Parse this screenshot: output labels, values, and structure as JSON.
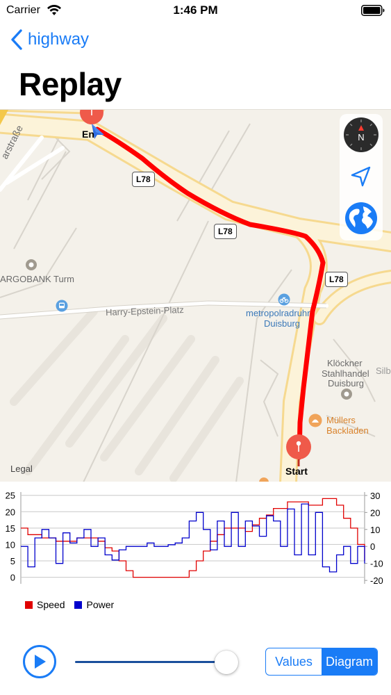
{
  "status_bar": {
    "carrier": "Carrier",
    "time": "1:46 PM"
  },
  "nav": {
    "back_label": "highway",
    "title": "Replay"
  },
  "map": {
    "labels": {
      "street_fragment": "arstraße",
      "argobank": "ARGOBANK Turm",
      "square": "Harry-Epstein-Platz",
      "station_1": "metropolradruhr",
      "station_2": "Duisburg",
      "kloeckner_1": "Klöckner",
      "kloeckner_2": "Stahlhandel",
      "kloeckner_3": "Duisburg",
      "silb": "Silb",
      "bakery_1": "Müllers",
      "bakery_2": "Backladen",
      "legal": "Legal"
    },
    "road_shields": [
      "L78",
      "L78",
      "L78"
    ],
    "start_label": "Start",
    "end_label": "En",
    "compass_letter": "N",
    "route_color": "#ff0000"
  },
  "chart_data": {
    "type": "line",
    "x": [
      0,
      1,
      2,
      3,
      4,
      5,
      6,
      7,
      8,
      9,
      10,
      11,
      12,
      13,
      14,
      15,
      16,
      17,
      18,
      19,
      20,
      21,
      22,
      23,
      24,
      25,
      26,
      27,
      28,
      29,
      30,
      31,
      32,
      33,
      34,
      35,
      36,
      37,
      38,
      39,
      40,
      41,
      42,
      43,
      44,
      45,
      46,
      47,
      48,
      49
    ],
    "series": [
      {
        "name": "Speed",
        "color": "#e00000",
        "axis": "left",
        "values": [
          15,
          13,
          13,
          12,
          12,
          11,
          11,
          11,
          12,
          12,
          12,
          11,
          9,
          8,
          5,
          2,
          0,
          0,
          0,
          0,
          0,
          0,
          0,
          0,
          2,
          5,
          8,
          11,
          13,
          15,
          15,
          15,
          14,
          16,
          18,
          19,
          21,
          21,
          23,
          23,
          23,
          22,
          22,
          24,
          24,
          22,
          18,
          15,
          10,
          5
        ]
      },
      {
        "name": "Power",
        "color": "#0000cc",
        "axis": "right",
        "values": [
          0,
          -12,
          5,
          10,
          5,
          -10,
          8,
          2,
          5,
          10,
          0,
          5,
          -5,
          -8,
          -2,
          0,
          0,
          0,
          2,
          0,
          0,
          1,
          2,
          5,
          15,
          20,
          10,
          -2,
          15,
          0,
          20,
          0,
          15,
          12,
          6,
          18,
          15,
          0,
          22,
          -5,
          25,
          -5,
          20,
          -12,
          -15,
          -5,
          0,
          -10,
          0,
          -10
        ]
      }
    ],
    "y_left": {
      "lim": [
        -2,
        26
      ],
      "ticks": [
        "25",
        "20",
        "15",
        "10",
        "5",
        "0"
      ]
    },
    "y_right": {
      "lim": [
        -22,
        32
      ],
      "ticks": [
        "30",
        "20",
        "10",
        "0",
        "-10",
        "-20"
      ]
    },
    "grid": true,
    "legend": "bottom-left"
  },
  "controls": {
    "slider_value": 0.94,
    "segments": [
      "Values",
      "Diagram"
    ],
    "selected_segment": 1
  }
}
